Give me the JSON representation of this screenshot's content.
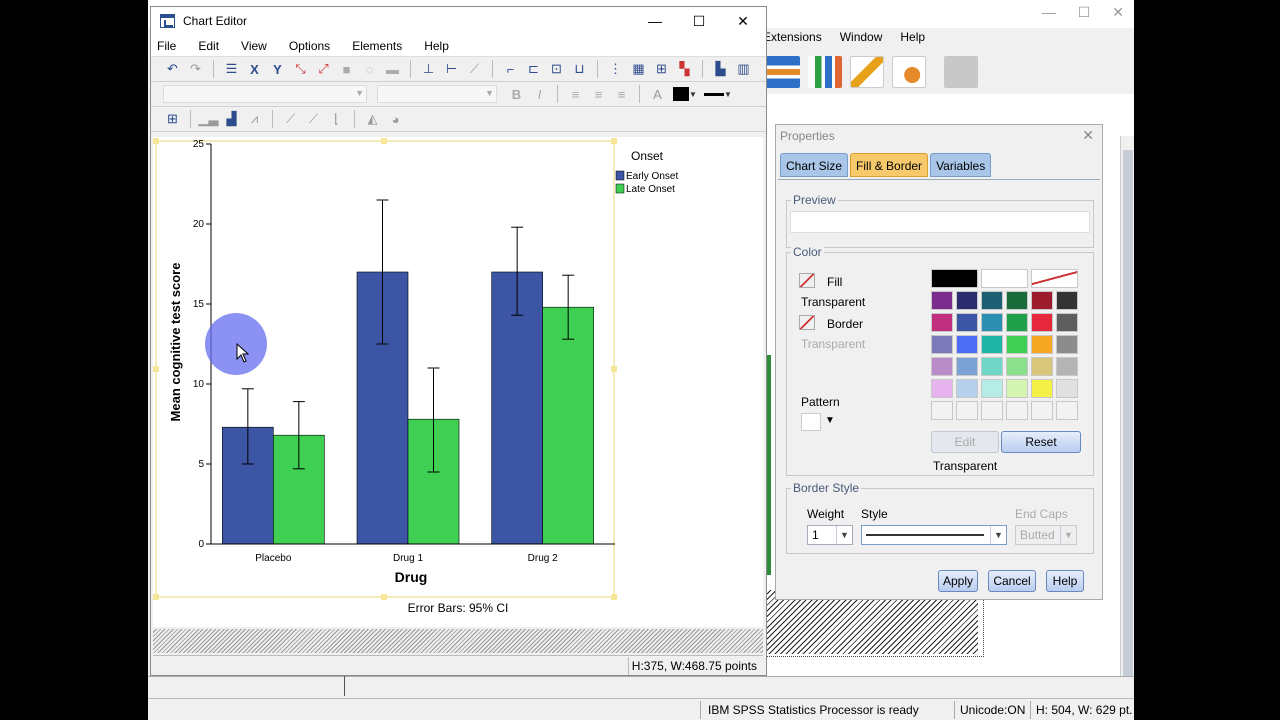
{
  "background_window": {
    "menu": [
      "Extensions",
      "Window",
      "Help"
    ],
    "status": {
      "message": "IBM SPSS Statistics Processor is ready",
      "unicode": "Unicode:ON",
      "size": "H: 504, W: 629 pt."
    }
  },
  "chart_editor": {
    "title": "Chart Editor",
    "menu": [
      "File",
      "Edit",
      "View",
      "Options",
      "Elements",
      "Help"
    ],
    "status_text": "H:375, W:468.75 points"
  },
  "chart_data": {
    "type": "bar",
    "categories": [
      "Placebo",
      "Drug 1",
      "Drug 2"
    ],
    "series": [
      {
        "name": "Early Onset",
        "values": [
          7.3,
          17.0,
          17.0
        ],
        "ci_low": [
          5.0,
          12.5,
          14.3
        ],
        "ci_high": [
          9.7,
          21.5,
          19.8
        ],
        "color": "#3c55a5"
      },
      {
        "name": "Late Onset",
        "values": [
          6.8,
          7.8,
          14.8
        ],
        "ci_low": [
          4.7,
          4.5,
          12.8
        ],
        "ci_high": [
          8.9,
          11.0,
          16.8
        ],
        "color": "#3ecf53"
      }
    ],
    "xlabel": "Drug",
    "ylabel": "Mean cognitive test score",
    "ylim": [
      0,
      25
    ],
    "yticks": [
      0,
      5,
      10,
      15,
      20,
      25
    ],
    "legend_title": "Onset",
    "legend_position": "top-right",
    "footnote": "Error Bars: 95% CI"
  },
  "properties": {
    "title": "Properties",
    "tabs": [
      "Chart Size",
      "Fill & Border",
      "Variables"
    ],
    "active_tab": "Fill & Border",
    "preview_label": "Preview",
    "color_label": "Color",
    "fill_label": "Fill",
    "fill_value": "Transparent",
    "border_label": "Border",
    "border_value": "Transparent",
    "pattern_label": "Pattern",
    "edit_button": "Edit",
    "reset_button": "Reset",
    "selected_color_text": "Transparent",
    "border_style_label": "Border Style",
    "weight_label": "Weight",
    "weight_value": "1",
    "style_label": "Style",
    "end_caps_label": "End Caps",
    "end_caps_value": "Butted",
    "apply_button": "Apply",
    "cancel_button": "Cancel",
    "help_button": "Help",
    "palette": [
      [
        "#000000",
        "#ffffff",
        "transparent"
      ],
      [
        "#7b2d8e",
        "#2c2d6e",
        "#1f5f74",
        "#1a6b3a",
        "#9c1c2e",
        "#333333"
      ],
      [
        "#c0307e",
        "#3c55a5",
        "#2c8fb2",
        "#21a04b",
        "#e5283b",
        "#5e5e5e"
      ],
      [
        "#7b79b8",
        "#4d6cf5",
        "#1fb3a3",
        "#3ecf53",
        "#f5a623",
        "#8c8c8c"
      ],
      [
        "#b98cc8",
        "#7ba2d3",
        "#6fd6c8",
        "#8be08e",
        "#d8c77a",
        "#b4b4b4"
      ],
      [
        "#e7b3ef",
        "#b5d0ea",
        "#b6ece6",
        "#d5f5b3",
        "#f5f046",
        "#e0e0e0"
      ],
      [
        "#f2f2f2",
        "#f2f2f2",
        "#f2f2f2",
        "#f2f2f2",
        "#f2f2f2",
        "#f2f2f2"
      ]
    ]
  }
}
